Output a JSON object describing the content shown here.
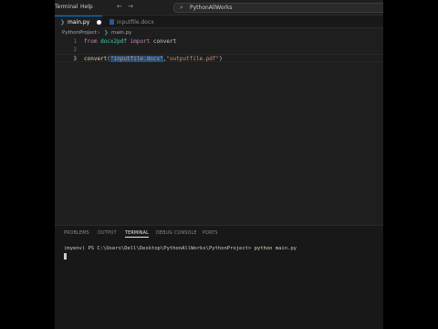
{
  "titlebar": {
    "menu": [
      "Terminal",
      "Help"
    ],
    "search_text": "PythonAllWorks"
  },
  "tabs": [
    {
      "label": "main.py",
      "modified": true,
      "active": true
    },
    {
      "label": "inputfile.docx",
      "modified": false,
      "active": false
    }
  ],
  "breadcrumb": [
    "PythonProject",
    "main.py"
  ],
  "editor": {
    "lines": [
      {
        "number": "1",
        "kw": "from",
        "mod": "docx2pdf",
        "kw2": "import",
        "name": "convert"
      },
      {
        "number": "2"
      },
      {
        "number": "3",
        "fn": "convert",
        "arg1": "\"inputfile.docx\"",
        "arg2": "\"outputfile.pdf\""
      }
    ]
  },
  "panel": {
    "tabs": [
      "PROBLEMS",
      "OUTPUT",
      "TERMINAL",
      "DEBUG CONSOLE",
      "PORTS"
    ],
    "active_tab": "TERMINAL",
    "terminal_prompt": "(myenv) PS C:\\Users\\Dell\\Desktop\\PythonAllWorks\\PythonProject> ",
    "terminal_cmd": "python",
    "terminal_arg": " main.py"
  },
  "colors": {
    "accent": "#0078d4",
    "editor_bg": "#1e1e1e",
    "panel_bg": "#181818"
  }
}
